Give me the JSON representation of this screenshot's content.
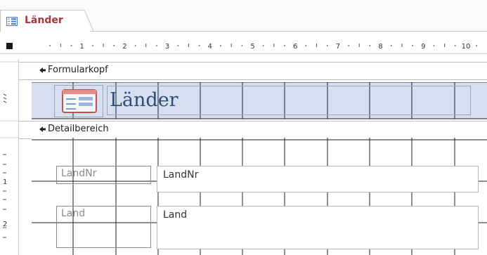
{
  "tab": {
    "label": "Länder",
    "icon": "form-icon",
    "accent": "#a4373a"
  },
  "ruler": {
    "ticks": [
      "1",
      "2",
      "3",
      "4",
      "5",
      "6",
      "7",
      "8",
      "9",
      "10"
    ],
    "vticks": [
      "1",
      "2"
    ]
  },
  "sections": {
    "header": {
      "label": "Formularkopf",
      "background": "#d5dff0"
    },
    "detail": {
      "label": "Detailbereich"
    }
  },
  "form_header": {
    "title": "Länder",
    "icon": "form-icon",
    "title_color": "#2f4d78"
  },
  "fields": [
    {
      "label": "LandNr",
      "control": "LandNr"
    },
    {
      "label": "Land",
      "control": "Land"
    }
  ]
}
